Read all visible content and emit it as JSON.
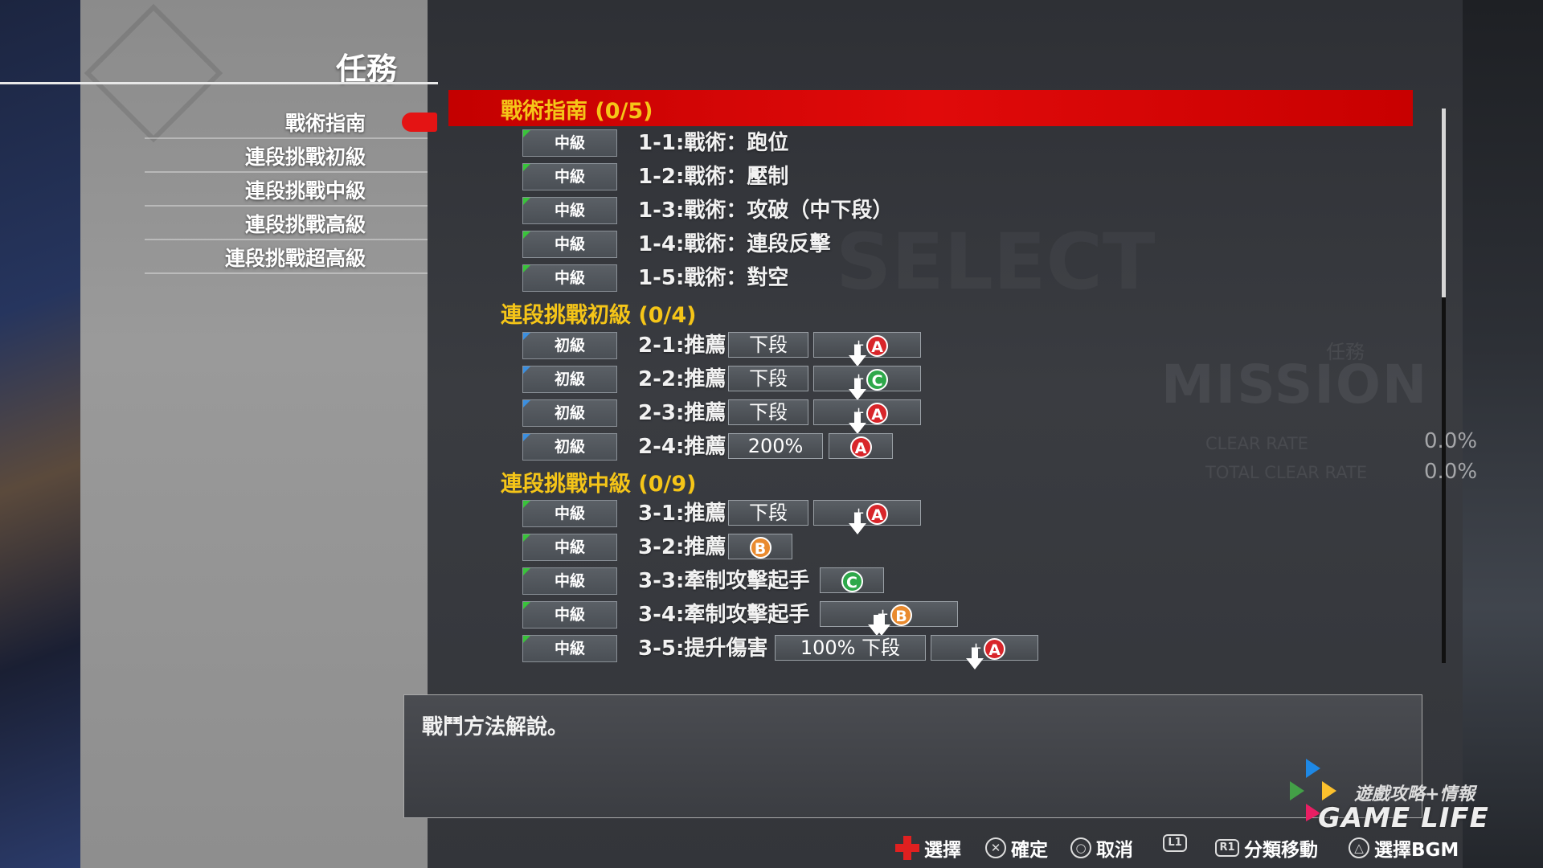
{
  "menu": {
    "title": "任務",
    "items": [
      "戰術指南",
      "連段挑戰初級",
      "連段挑戰中級",
      "連段挑戰高級",
      "連段挑戰超高級"
    ],
    "selected": "戰術指南"
  },
  "background": {
    "mission_sub": "任務",
    "mission_word": "MISSION",
    "clear_rate": "CLEAR RATE",
    "total_clear_rate": "TOTAL CLEAR RATE",
    "clear_rate_value": "0.0%",
    "total_clear_rate_value": "0.0%"
  },
  "sections": [
    {
      "title": "戰術指南 (0/5)"
    },
    {
      "title": "連段挑戰初級 (0/4)"
    },
    {
      "title": "連段挑戰中級 (0/9)"
    }
  ],
  "rows": [
    {
      "level": "中級",
      "label": "1-1:戰術：跑位"
    },
    {
      "level": "中級",
      "label": "1-2:戰術：壓制"
    },
    {
      "level": "中級",
      "label": "1-3:戰術：攻破（中下段）"
    },
    {
      "level": "中級",
      "label": "1-4:戰術：連段反擊"
    },
    {
      "level": "中級",
      "label": "1-5:戰術：對空"
    },
    {
      "level": "初級",
      "label": "2-1:推薦",
      "tag": "下段",
      "input": "down-A"
    },
    {
      "level": "初級",
      "label": "2-2:推薦",
      "tag": "下段",
      "input": "down-C"
    },
    {
      "level": "初級",
      "label": "2-3:推薦",
      "tag": "下段",
      "input": "down-A"
    },
    {
      "level": "初級",
      "label": "2-4:推薦",
      "tag": "200%",
      "input": "A"
    },
    {
      "level": "中級",
      "label": "3-1:推薦",
      "tag": "下段",
      "input": "down-A"
    },
    {
      "level": "中級",
      "label": "3-2:推薦",
      "input": "B"
    },
    {
      "level": "中級",
      "label": "3-3:牽制攻擊起手",
      "input": "C"
    },
    {
      "level": "中級",
      "label": "3-4:牽制攻擊起手",
      "input": "down-down-B"
    },
    {
      "level": "中級",
      "label": "3-5:提升傷害",
      "tag": "100% 下段",
      "input": "down-A"
    }
  ],
  "buttons": {
    "a": "A",
    "b": "B",
    "c": "C",
    "plus": "+"
  },
  "description": "戰鬥方法解說。",
  "footer": {
    "select": "選擇",
    "confirm": "確定",
    "cancel": "取消",
    "l1": "L1",
    "r1": "R1",
    "category_move": "分類移動",
    "select_bgm": "選擇BGM"
  },
  "watermark": {
    "text": "GAME LIFE",
    "sub": "遊戲攻略+情報"
  },
  "colors": {
    "accent_red": "#e00a0a",
    "section_yellow": "#f5c518",
    "btn_a": "#d8252a",
    "btn_b": "#e98a2e",
    "btn_c": "#2ea84a"
  }
}
